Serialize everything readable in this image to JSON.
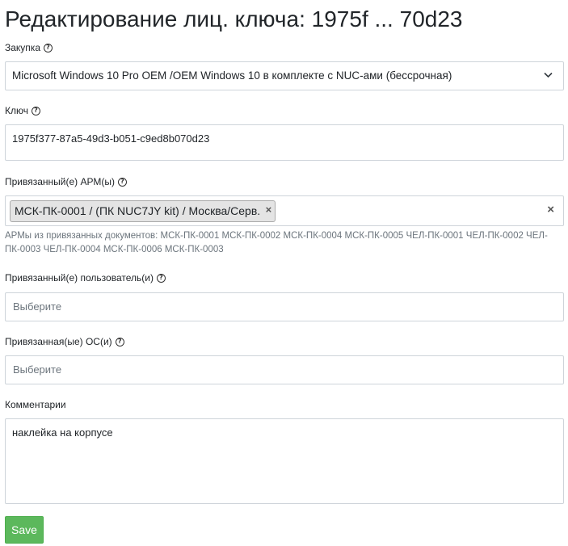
{
  "header": {
    "title": "Редактирование лиц. ключа: 1975f ... 70d23"
  },
  "form": {
    "purchase": {
      "label": "Закупка",
      "value": "Microsoft Windows 10 Pro OEM /OEM Windows 10 в комплекте с NUC-ами (бессрочная)"
    },
    "key": {
      "label": "Ключ",
      "value": "1975f377-87a5-49d3-b051-c9ed8b070d23"
    },
    "workstations": {
      "label": "Привязанный(е) АРМ(ы)",
      "tag": "МСК-ПК-0001 / (ПК NUC7JY kit) / Москва/Серв.",
      "tag_remove": "×",
      "clear": "×",
      "hint": "АРМы из привязанных документов: МСК-ПК-0001 МСК-ПК-0002 МСК-ПК-0004 МСК-ПК-0005 ЧЕЛ-ПК-0001 ЧЕЛ-ПК-0002 ЧЕЛ-ПК-0003 ЧЕЛ-ПК-0004 МСК-ПК-0006 МСК-ПК-0003"
    },
    "users": {
      "label": "Привязанный(е) пользователь(и)",
      "placeholder": "Выберите"
    },
    "os": {
      "label": "Привязанная(ые) ОС(и)",
      "placeholder": "Выберите"
    },
    "comments": {
      "label": "Комментарии",
      "value": "наклейка на корпусе"
    },
    "save_label": "Save"
  },
  "icons": {
    "help": "?",
    "help_name": "question-circle-icon",
    "chevron_name": "chevron-down-icon"
  },
  "colors": {
    "save_button": "#5cb85c",
    "border": "#ced4da",
    "hint_text": "#6c757d"
  }
}
